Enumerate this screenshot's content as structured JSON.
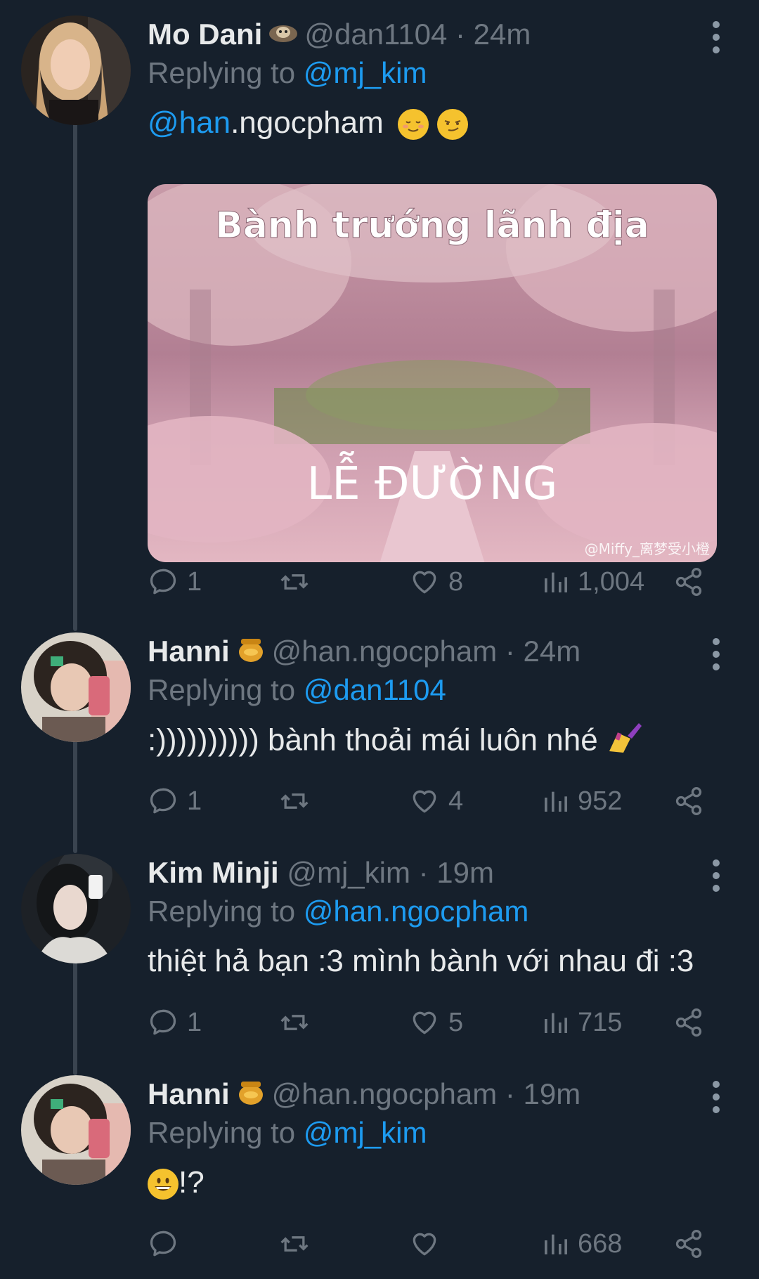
{
  "tweets": [
    {
      "name": "Mo Dani",
      "handle": "@dan1104 · 24m",
      "replying_prefix": "Replying to ",
      "replying_to": "@mj_kim",
      "text_mention": "@han",
      "text": ".ngocpham",
      "media": {
        "caption_top": "Bành trướng lãnh địa",
        "caption_bottom": "LỄ ĐƯỜNG",
        "watermark": "@Miffy_离梦受小橙"
      },
      "counts": {
        "replies": "1",
        "retweets": "",
        "likes": "8",
        "views": "1,004"
      }
    },
    {
      "name": "Hanni",
      "handle": "@han.ngocpham · 24m",
      "replying_prefix": "Replying to ",
      "replying_to": "@dan1104",
      "text": ":)))))))))) bành thoải mái luôn nhé",
      "counts": {
        "replies": "1",
        "retweets": "",
        "likes": "4",
        "views": "952"
      }
    },
    {
      "name": "Kim Minji",
      "handle": "@mj_kim · 19m",
      "replying_prefix": "Replying to ",
      "replying_to": "@han.ngocpham",
      "text": "thiệt hả bạn :3 mình bành với nhau đi :3",
      "counts": {
        "replies": "1",
        "retweets": "",
        "likes": "5",
        "views": "715"
      }
    },
    {
      "name": "Hanni",
      "handle": "@han.ngocpham · 19m",
      "replying_prefix": "Replying to ",
      "replying_to": "@mj_kim",
      "text": "!?",
      "counts": {
        "replies": "",
        "retweets": "",
        "likes": "",
        "views": "668"
      }
    }
  ],
  "colors": {
    "background": "#16202c",
    "accent": "#1d9bf0",
    "muted": "#6e7781"
  },
  "icons": [
    "reply-icon",
    "retweet-icon",
    "like-icon",
    "views-icon",
    "share-icon",
    "more-options-icon"
  ]
}
